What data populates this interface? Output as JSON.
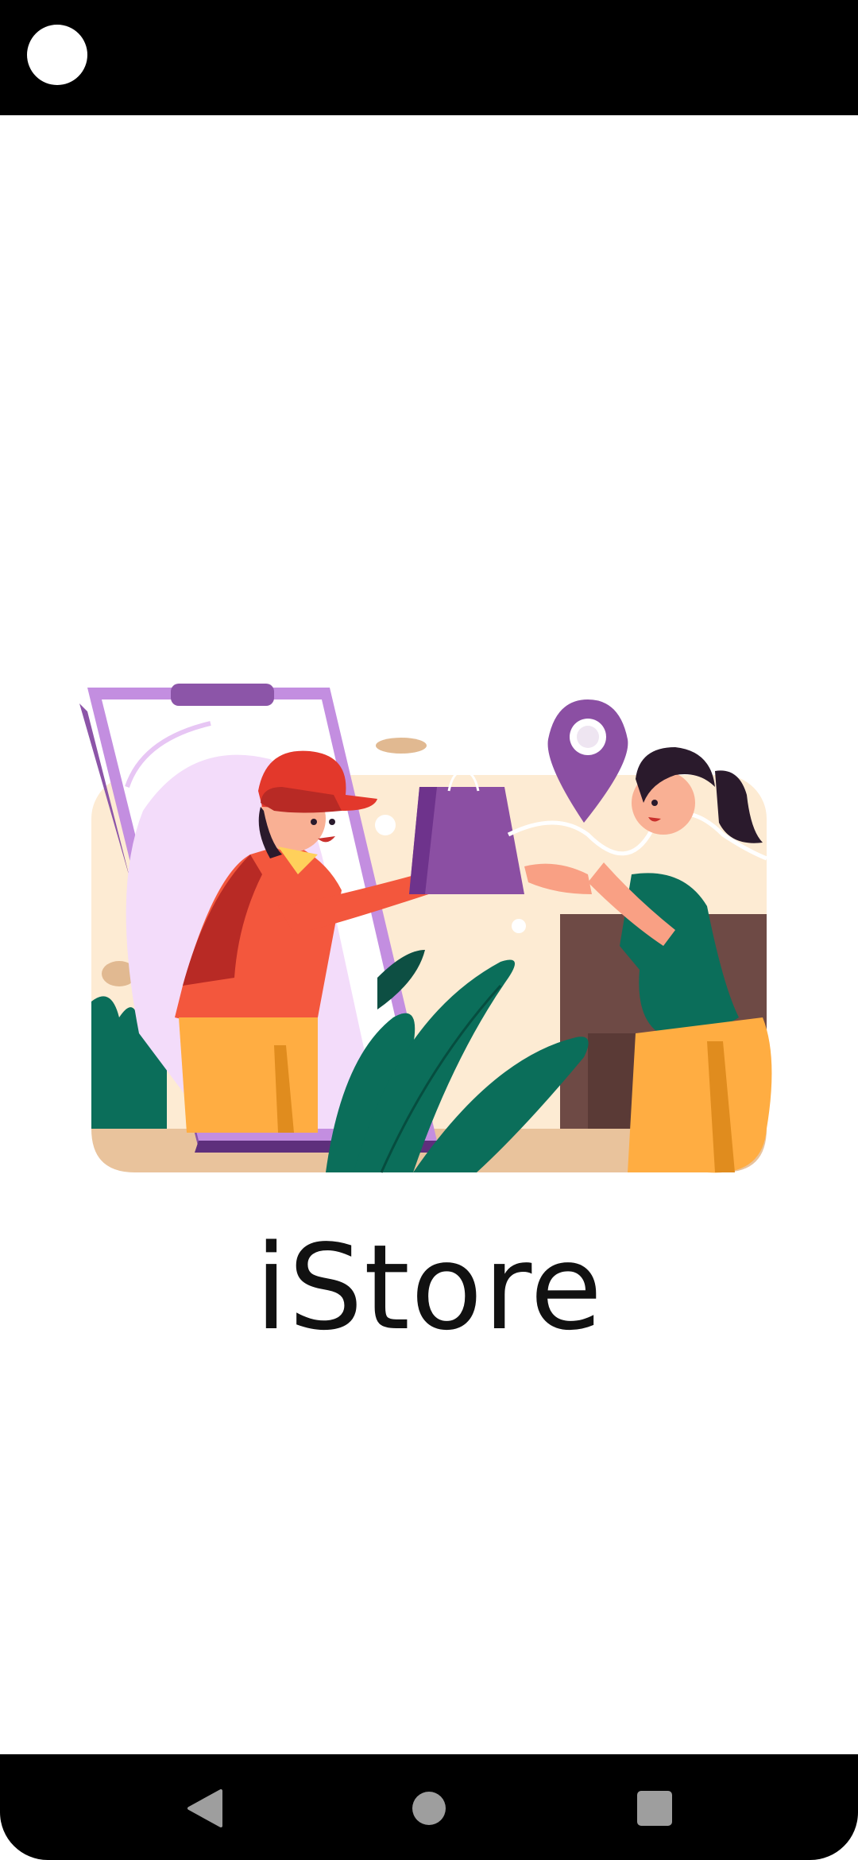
{
  "app": {
    "title": "iStore"
  },
  "navigation": {
    "back_icon": "back-triangle-icon",
    "home_icon": "home-circle-icon",
    "recents_icon": "recents-square-icon"
  },
  "colors": {
    "status_bar": "#000000",
    "nav_bar": "#000000",
    "nav_icons": "#9e9e9e",
    "accent_purple": "#8b4fa3",
    "accent_green": "#0b6e5a",
    "accent_orange": "#ffad42"
  }
}
